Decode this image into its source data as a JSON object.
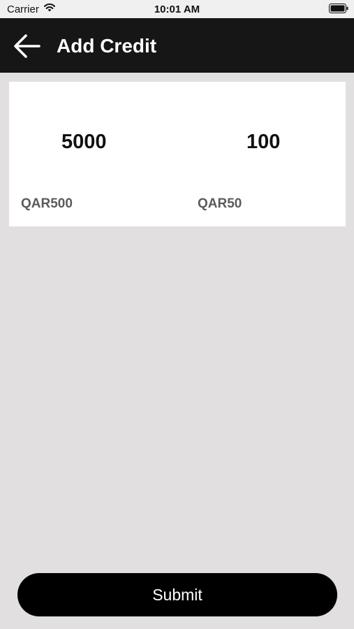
{
  "status_bar": {
    "carrier": "Carrier",
    "time": "10:01 AM"
  },
  "header": {
    "title": "Add Credit",
    "back_icon": "arrow-left-icon"
  },
  "packages": [
    {
      "credits": "5000",
      "price": "QAR500"
    },
    {
      "credits": "100",
      "price": "QAR50"
    }
  ],
  "actions": {
    "submit_label": "Submit"
  },
  "colors": {
    "background": "#e1dfe0",
    "header": "#161616",
    "card": "#ffffff",
    "button": "#000000"
  }
}
